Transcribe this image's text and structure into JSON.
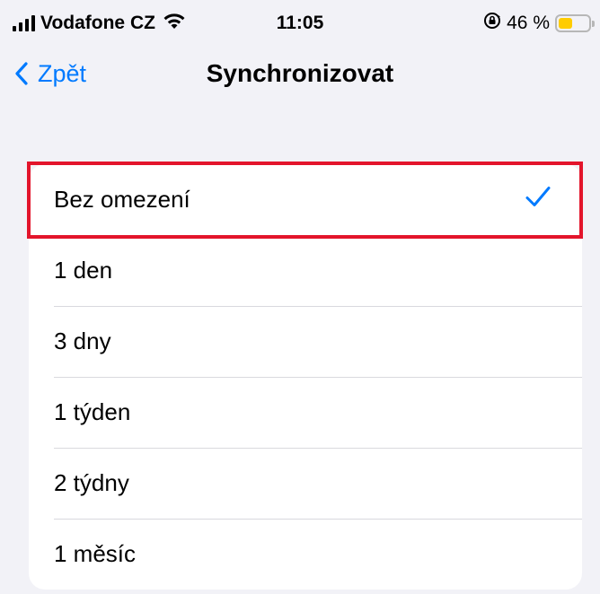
{
  "status_bar": {
    "carrier": "Vodafone CZ",
    "time": "11:05",
    "battery_percent": "46 %",
    "battery_level": 0.46,
    "battery_color": "#ffcc00",
    "icons": [
      "signal-icon",
      "wifi-icon",
      "orientation-lock-icon",
      "battery-icon"
    ]
  },
  "nav": {
    "back_label": "Zpět",
    "title": "Synchronizovat"
  },
  "accent_color": "#007aff",
  "highlight_color": "#e3152b",
  "options": [
    {
      "label": "Bez omezení",
      "selected": true
    },
    {
      "label": "1 den",
      "selected": false
    },
    {
      "label": "3 dny",
      "selected": false
    },
    {
      "label": "1 týden",
      "selected": false
    },
    {
      "label": "2 týdny",
      "selected": false
    },
    {
      "label": "1 měsíc",
      "selected": false
    }
  ]
}
